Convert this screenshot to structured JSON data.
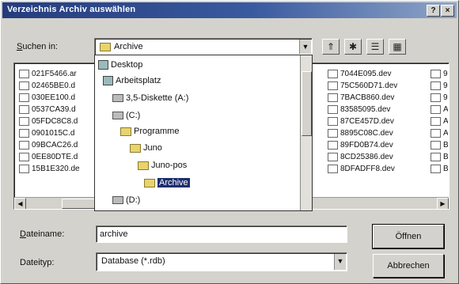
{
  "window": {
    "title": "Verzeichnis Archiv auswählen",
    "help_label": "?",
    "close_label": "×"
  },
  "lookin": {
    "label_u": "S",
    "label_rest": "uchen in:",
    "value": "Archive"
  },
  "toolbar": {
    "up_icon": "up-folder-icon",
    "newfolder_icon": "new-folder-icon",
    "list_icon": "list-view-icon",
    "details_icon": "details-view-icon"
  },
  "files_left": [
    "021F5466.ar",
    "02465BE0.d",
    "030EE100.d",
    "0537CA39.d",
    "05FDC8C8.d",
    "0901015C.d",
    "09BCAC26.d",
    "0EE80DTE.d",
    "15B1E320.de"
  ],
  "files_right": [
    "7044E095.dev",
    "75C560D71.dev",
    "7BACB860.dev",
    "83585095.dev",
    "87CE457D.dev",
    "8895C08C.dev",
    "89FD0B74.dev",
    "8CD25386.dev",
    "8DFADFF8.dev"
  ],
  "files_far": [
    "9",
    "9",
    "9",
    "A",
    "A",
    "A",
    "B",
    "B",
    "B"
  ],
  "dropdown": {
    "items": [
      {
        "label": "Desktop",
        "type": "desktop",
        "indent": 0
      },
      {
        "label": "Arbeitsplatz",
        "type": "pc",
        "indent": 1
      },
      {
        "label": "3,5-Diskette (A:)",
        "type": "drive",
        "indent": 2
      },
      {
        "label": "(C:)",
        "type": "drive",
        "indent": 2
      },
      {
        "label": "Programme",
        "type": "folder",
        "indent": 3
      },
      {
        "label": "Juno",
        "type": "folder",
        "indent": 4
      },
      {
        "label": "Juno-pos",
        "type": "folder",
        "indent": 5
      },
      {
        "label": "Archive",
        "type": "folder",
        "indent": 6,
        "selected": true
      },
      {
        "label": "(D:)",
        "type": "drive",
        "indent": 2
      }
    ]
  },
  "filename": {
    "label_u": "D",
    "label_rest": "ateiname:",
    "value": "archive"
  },
  "filetype": {
    "label": "Dateityp:",
    "value": "Database (*.rdb)"
  },
  "buttons": {
    "open": "Öffnen",
    "cancel": "Abbrechen"
  },
  "colors": {
    "titlebar_start": "#243c7c",
    "selection": "#1e2e6e",
    "face": "#d4d2cc"
  }
}
